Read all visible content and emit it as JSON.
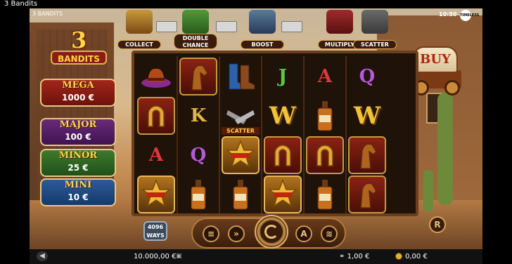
{
  "window": {
    "title": "3 Bandits"
  },
  "game": {
    "small_title": "3 BANDITS",
    "logo_number": "3",
    "logo_word": "BANDITS",
    "clock": "10:50",
    "badge_text": "TIMELESS",
    "buy_label": "BUY",
    "ways": {
      "number": "4096",
      "label": "WAYS"
    },
    "jackpots": [
      {
        "name": "MEGA",
        "value": "1000 €"
      },
      {
        "name": "MAJOR",
        "value": "100 €"
      },
      {
        "name": "MINOR",
        "value": "25 €"
      },
      {
        "name": "MINI",
        "value": "10 €"
      }
    ],
    "features": [
      {
        "label": "COLLECT"
      },
      {
        "label": "DOUBLE CHANCE"
      },
      {
        "label": "BOOST"
      },
      {
        "label": "MULTIPLY"
      },
      {
        "label": "SCATTER"
      }
    ],
    "reels": [
      [
        "cowboy-hat",
        "horseshoe",
        "A",
        "sheriff-badge"
      ],
      [
        "horse",
        "K",
        "Q",
        "whiskey"
      ],
      [
        "boots",
        "revolvers",
        "sheriff-badge",
        "whiskey"
      ],
      [
        "J",
        "W",
        "horseshoe",
        "sheriff-badge"
      ],
      [
        "A",
        "whiskey",
        "horseshoe",
        "whiskey"
      ],
      [
        "Q",
        "W",
        "horse",
        "horse"
      ]
    ],
    "scatter_label": "SCATTER",
    "controls": {
      "autoplay": "≡",
      "turbo": "»",
      "auto": "A",
      "bet": "≋",
      "r": "R"
    }
  },
  "status": {
    "balance": "10.000,00 €",
    "bet": "1,00 €",
    "win": "0,00 €"
  },
  "colors": {
    "gold": "#ffd34a",
    "wood": "#6b3e1e"
  }
}
